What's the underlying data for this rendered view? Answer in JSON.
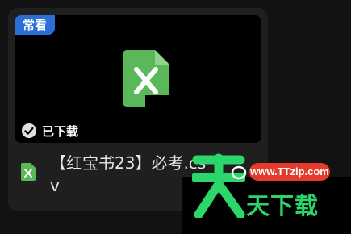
{
  "card": {
    "tag_label": "常看",
    "download_status": "已下载",
    "file_name": "【红宝书23】必考.csv",
    "file_type_icon": "spreadsheet-file-icon",
    "check_icon": "check-circle-icon"
  },
  "watermark": {
    "url": "www.TTzip.com",
    "text": "天下载",
    "logo_char": "天"
  },
  "colors": {
    "tag_bg": "#2b6fd6",
    "file_icon_green": "#5bb85a",
    "watermark_green": "#2bd66a",
    "watermark_red": "#e53b2c"
  }
}
